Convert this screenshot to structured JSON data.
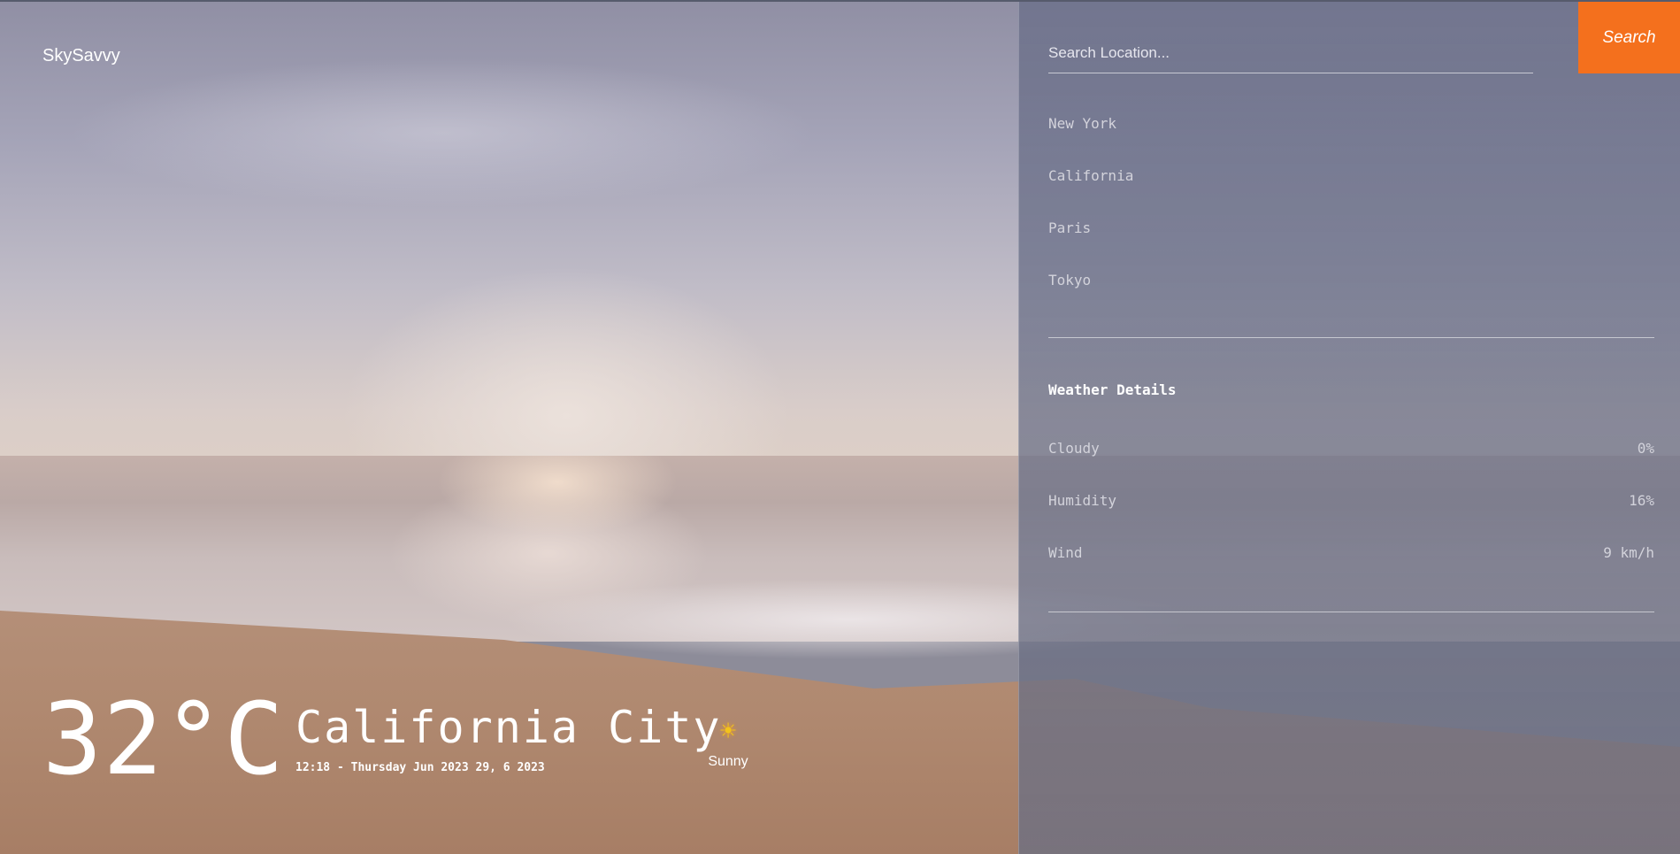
{
  "app": {
    "brand": "SkySavvy"
  },
  "current": {
    "temperature": "32°C",
    "city": "California City",
    "datetime": "12:18 - Thursday Jun 2023 29, 6 2023",
    "condition": "Sunny",
    "condition_icon": "sun-icon"
  },
  "search": {
    "placeholder": "Search Location...",
    "value": "",
    "button_label": "Search"
  },
  "recent_locations": [
    "New York",
    "California",
    "Paris",
    "Tokyo"
  ],
  "details": {
    "title": "Weather Details",
    "rows": [
      {
        "label": "Cloudy",
        "value": "0%"
      },
      {
        "label": "Humidity",
        "value": "16%"
      },
      {
        "label": "Wind",
        "value": "9 km/h"
      }
    ]
  },
  "colors": {
    "accent": "#f4701d",
    "text": "#ffffff",
    "muted_text": "#d3d3db"
  }
}
